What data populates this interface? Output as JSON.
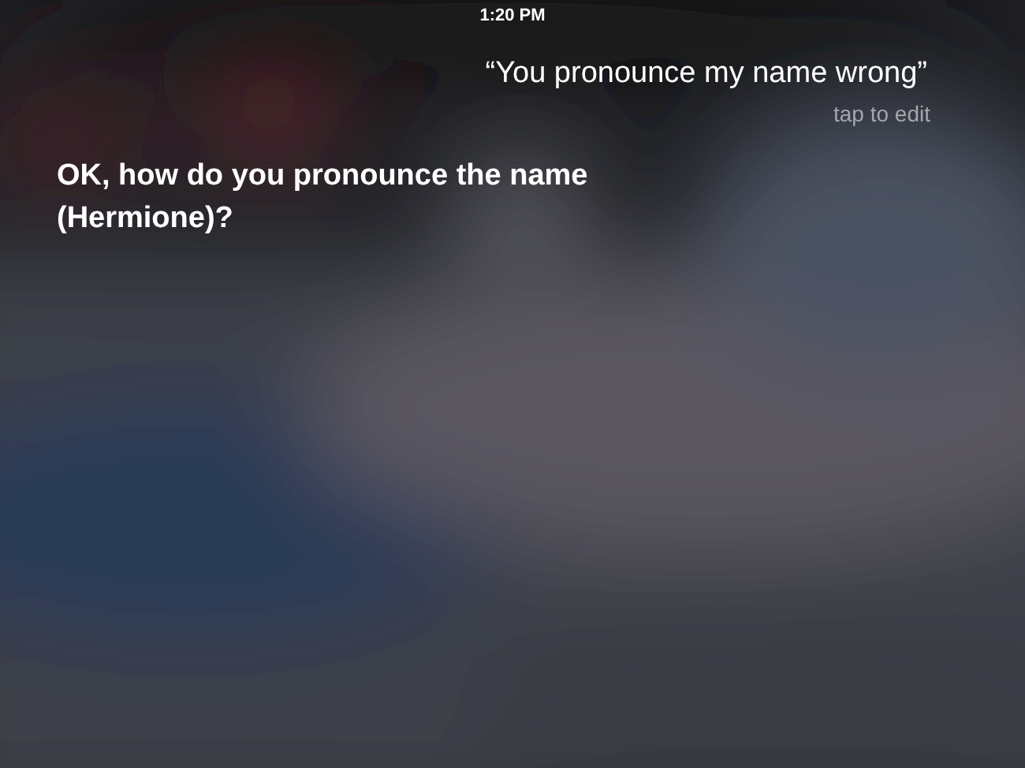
{
  "status_bar": {
    "time": "1:20 PM"
  },
  "user_utterance": {
    "text": "“You pronounce my name wrong”",
    "hint": "tap to edit"
  },
  "siri_response": {
    "text": "OK, how do you pronounce the name (Hermione)?"
  }
}
